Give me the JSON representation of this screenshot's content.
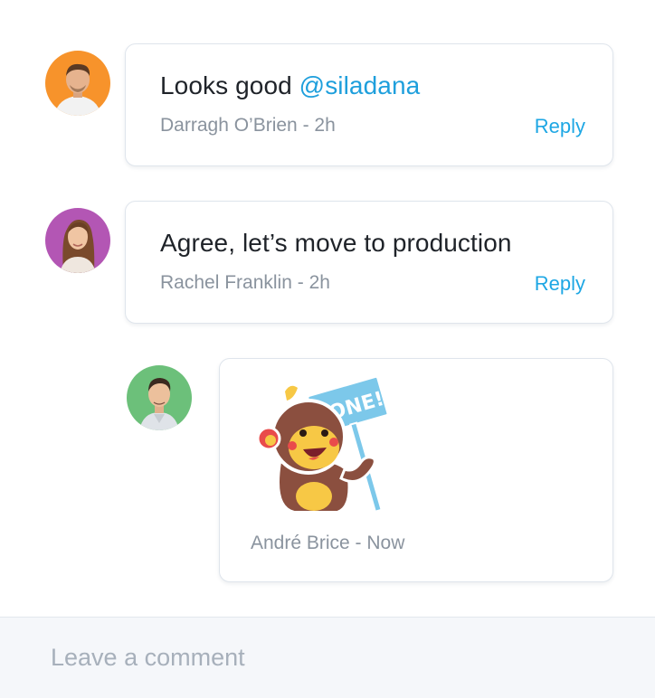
{
  "comments": [
    {
      "text": "Looks good ",
      "mention": "@siladana",
      "author": "Darragh O’Brien",
      "time": "2h",
      "separator": " - ",
      "reply_label": "Reply",
      "avatar_icon": "avatar-man-orange",
      "avatar_bg": "#f7932b"
    },
    {
      "text": "Agree, let’s move to production",
      "author": "Rachel Franklin",
      "time": "2h",
      "separator": " - ",
      "reply_label": "Reply",
      "avatar_icon": "avatar-woman-purple",
      "avatar_bg": "#b356b4"
    },
    {
      "sticker_icon": "monkey-done-sticker",
      "sticker_sign_text": "DONE!",
      "author": "André Brice",
      "time": "Now",
      "separator": " - ",
      "avatar_icon": "avatar-man-green",
      "avatar_bg": "#6cc07a"
    }
  ],
  "comment_box": {
    "placeholder": "Leave a comment"
  },
  "colors": {
    "accent": "#1ea7e4",
    "meta_text": "#8a939e",
    "body_text": "#1f2329",
    "border": "#dfe5ec"
  }
}
